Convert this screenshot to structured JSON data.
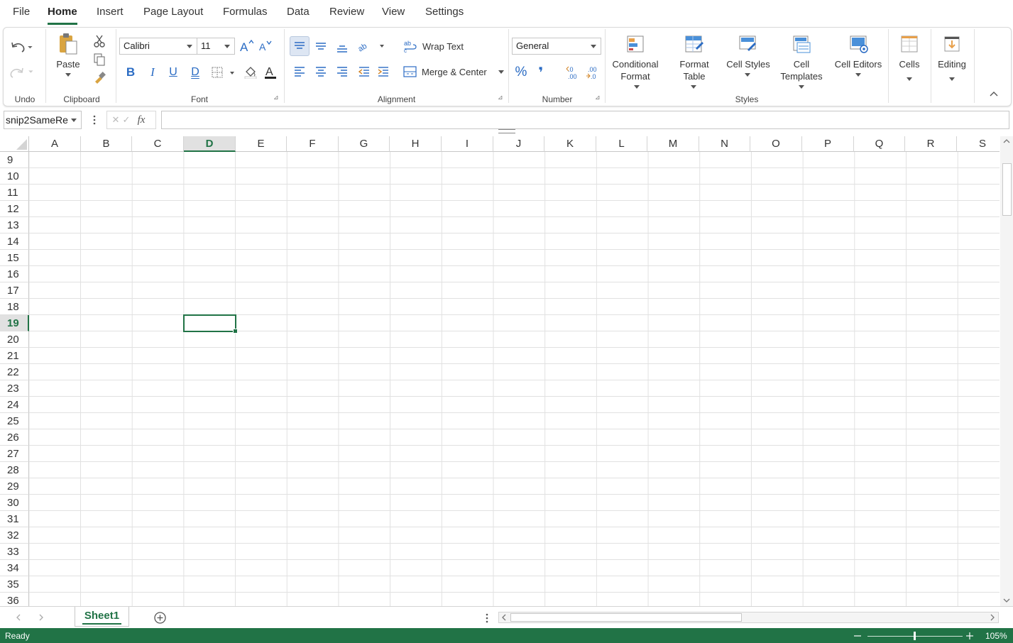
{
  "menu": {
    "tabs": [
      {
        "label": "File"
      },
      {
        "label": "Home"
      },
      {
        "label": "Insert"
      },
      {
        "label": "Page Layout"
      },
      {
        "label": "Formulas"
      },
      {
        "label": "Data"
      },
      {
        "label": "Review"
      },
      {
        "label": "View"
      },
      {
        "label": "Settings"
      }
    ],
    "active": "Home"
  },
  "ribbon": {
    "groups": {
      "undo": "Undo",
      "clipboard": "Clipboard",
      "font": "Font",
      "alignment": "Alignment",
      "number": "Number",
      "styles": "Styles"
    },
    "paste_label": "Paste",
    "font_name": "Calibri",
    "font_size": "11",
    "wrap_text": "Wrap Text",
    "merge_center": "Merge & Center",
    "number_format": "General",
    "conditional_format": [
      "Conditional",
      "Format"
    ],
    "format_table": [
      "Format",
      "Table"
    ],
    "cell_styles": "Cell Styles",
    "cell_templates": [
      "Cell",
      "Templates"
    ],
    "cell_editors": "Cell Editors",
    "cells": "Cells",
    "editing": "Editing",
    "bold": "B",
    "italic": "I",
    "underline": "U",
    "double_underline": "D",
    "percent": "%",
    "comma": "❜",
    "accent_color": "#217346",
    "icon_blue": "#2b6cc4"
  },
  "formula_bar": {
    "name_box": "snip2SameRe",
    "fx": "fx",
    "formula": ""
  },
  "grid": {
    "columns": [
      "A",
      "B",
      "C",
      "D",
      "E",
      "F",
      "G",
      "H",
      "I",
      "J",
      "K",
      "L",
      "M",
      "N",
      "O",
      "P",
      "Q",
      "R",
      "S"
    ],
    "active_column": "D",
    "rows": [
      "9",
      "10",
      "11",
      "12",
      "13",
      "14",
      "15",
      "16",
      "17",
      "18",
      "19",
      "20",
      "21",
      "22",
      "23",
      "24",
      "25",
      "26",
      "27",
      "28",
      "29",
      "30",
      "31",
      "32",
      "33",
      "34",
      "35",
      "36"
    ],
    "active_row": "19"
  },
  "sheets": {
    "tabs": [
      "Sheet1"
    ],
    "active": "Sheet1"
  },
  "status": {
    "text": "Ready",
    "zoom": "105%"
  }
}
